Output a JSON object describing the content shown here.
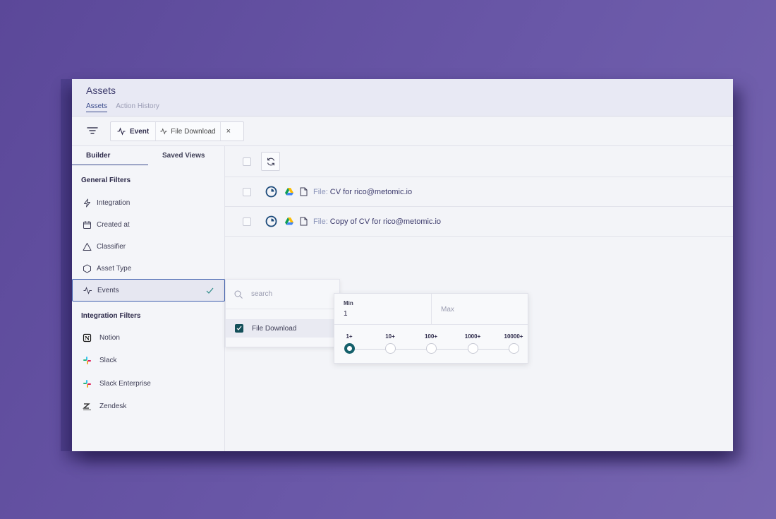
{
  "header": {
    "title": "Assets",
    "tabs": [
      {
        "label": "Assets",
        "active": true
      },
      {
        "label": "Action History",
        "active": false
      }
    ]
  },
  "filter_chip": {
    "field": "Event",
    "value": "File Download",
    "close": "×"
  },
  "left_panel": {
    "tabs": [
      "Builder",
      "Saved Views"
    ],
    "general_title": "General Filters",
    "general_items": [
      {
        "label": "Integration",
        "icon": "lightning-icon"
      },
      {
        "label": "Created at",
        "icon": "calendar-icon"
      },
      {
        "label": "Classifier",
        "icon": "triangle-icon"
      },
      {
        "label": "Asset Type",
        "icon": "hexagon-icon"
      },
      {
        "label": "Events",
        "icon": "activity-icon",
        "active": true
      }
    ],
    "integration_title": "Integration Filters",
    "integration_items": [
      {
        "label": "Notion",
        "icon": "notion-icon"
      },
      {
        "label": "Slack",
        "icon": "slack-icon"
      },
      {
        "label": "Slack Enterprise",
        "icon": "slack-icon"
      },
      {
        "label": "Zendesk",
        "icon": "zendesk-icon"
      }
    ]
  },
  "assets": [
    {
      "prefix": "File:",
      "name": "CV for rico@metomic.io"
    },
    {
      "prefix": "File:",
      "name": "Copy of CV for rico@metomic.io"
    }
  ],
  "event_dropdown": {
    "search_placeholder": "search",
    "option": "File Download",
    "option_checked": true
  },
  "range_dropdown": {
    "min_label": "Min",
    "min_value": "1",
    "max_placeholder": "Max",
    "steps": [
      "1+",
      "10+",
      "100+",
      "1000+",
      "10000+"
    ],
    "selected_step": 0
  },
  "colors": {
    "accent": "#3a4b8c",
    "teal": "#15606b",
    "background": "#5b4899"
  }
}
